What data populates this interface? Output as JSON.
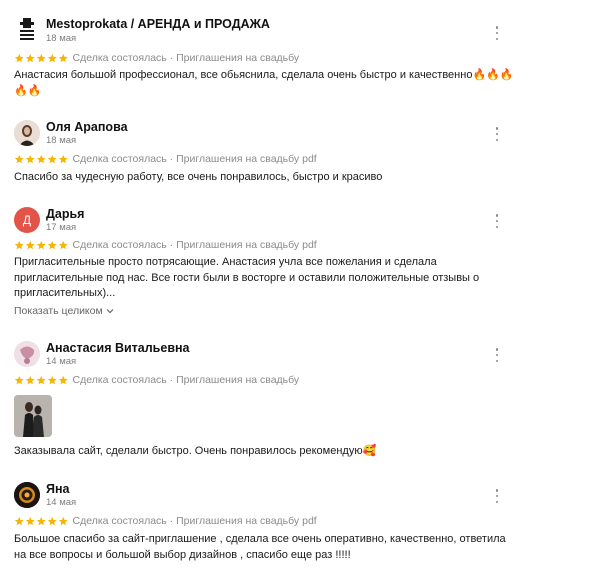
{
  "colors": {
    "star": "#f7b500",
    "avatar_darya": "#e2534a",
    "meta_text": "#8b8b8b",
    "date_text": "#7d7d7d"
  },
  "icons": {
    "star": "star-icon",
    "more": "more-vertical-icon",
    "chevron": "chevron-down-icon",
    "fire": "fire-emoji",
    "smile": "hugging-face-emoji"
  },
  "reviews": [
    {
      "name": "Mestoprokata / АРЕНДА и ПРОДАЖА",
      "date": "18 мая",
      "rating": 5,
      "meta": "Сделка состоялась · Приглашения на свадьбу",
      "text": "Анастасия большой профессионал, все обьяснила, сделала очень быстро и качественно🔥🔥🔥🔥🔥"
    },
    {
      "name": "Оля Арапова",
      "date": "18 мая",
      "rating": 5,
      "meta": "Сделка состоялась · Приглашения на свадьбу pdf",
      "text": "Спасибо за чудесную работу, все очень понравилось, быстро и красиво"
    },
    {
      "name": "Дарья",
      "avatar_letter": "Д",
      "date": "17 мая",
      "rating": 5,
      "meta": "Сделка состоялась · Приглашения на свадьбу pdf",
      "text": "Пригласительные просто потрясающие. Анастасия учла все пожелания и сделала пригласительные под нас. Все гости были в восторге и оставили положительные отзывы о пригласительных)...",
      "show_more": "Показать целиком"
    },
    {
      "name": "Анастасия Витальевна",
      "date": "14 мая",
      "rating": 5,
      "meta": "Сделка состоялась · Приглашения на свадьбу",
      "text": "Заказывала сайт, сделали быстро. Очень понравилось рекомендую🥰"
    },
    {
      "name": "Яна",
      "date": "14 мая",
      "rating": 5,
      "meta": "Сделка состоялась · Приглашения на свадьбу pdf",
      "text": "Большое спасибо за сайт-приглашение , сделала все очень оперативно, качественно, ответила на все вопросы и большой выбор дизайнов , спасибо еще раз !!!!!"
    }
  ]
}
